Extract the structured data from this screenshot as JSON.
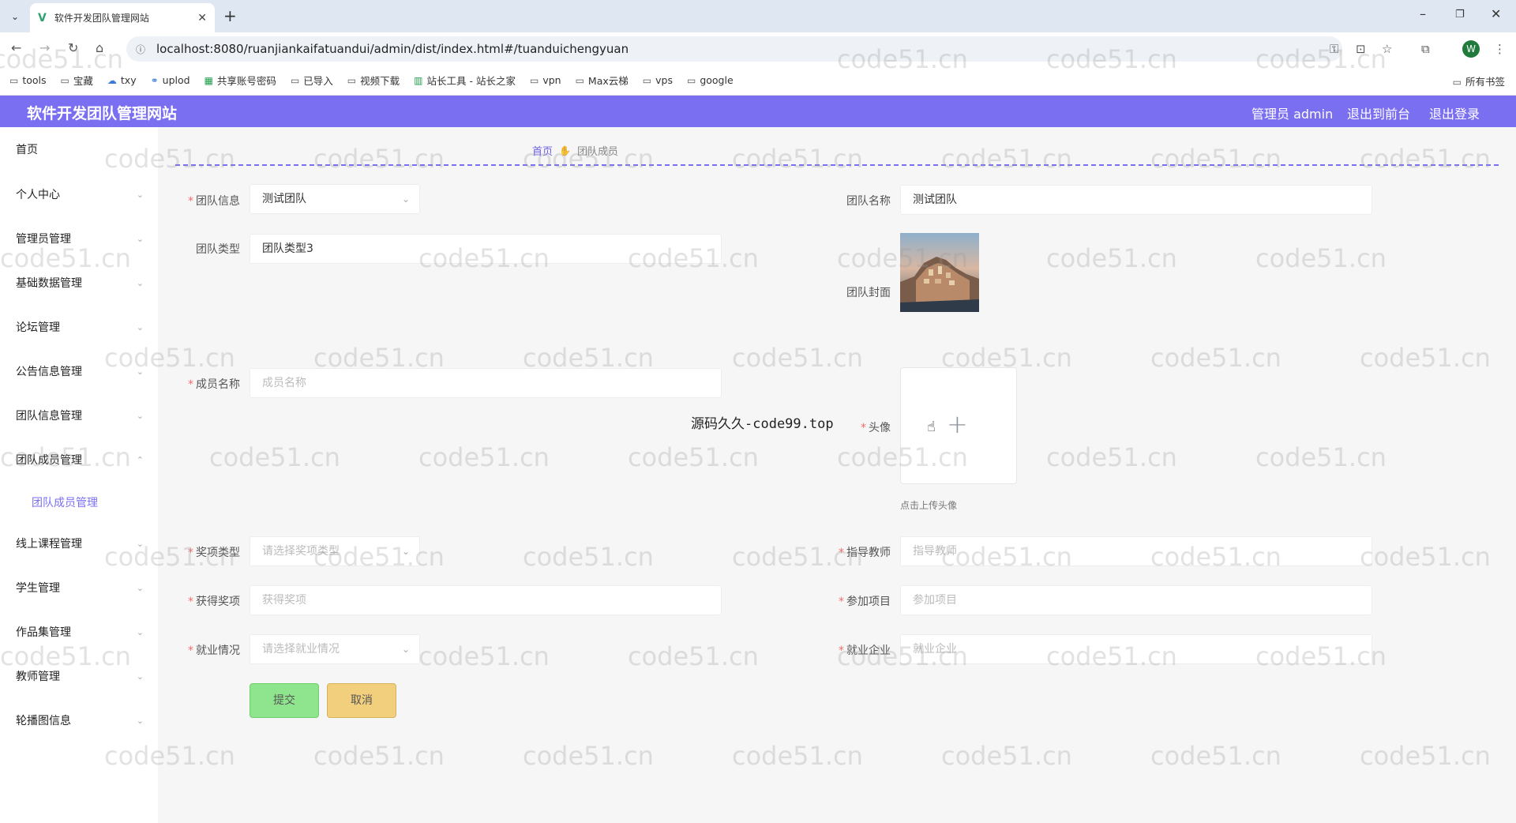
{
  "browser": {
    "tab_title": "软件开发团队管理网站",
    "url": "localhost:8080/ruanjiankaifatuandui/admin/dist/index.html#/tuanduichengyuan",
    "avatar_letter": "W",
    "bookmarks": [
      "tools",
      "宝藏",
      "txy",
      "uplod",
      "共享账号密码",
      "已导入",
      "视频下载",
      "站长工具 - 站长之家",
      "vpn",
      "Max云梯",
      "vps",
      "google"
    ],
    "all_bookmarks": "所有书签"
  },
  "header": {
    "title": "软件开发团队管理网站",
    "admin": "管理员 admin",
    "to_front": "退出到前台",
    "logout": "退出登录"
  },
  "sidebar": {
    "items": [
      "首页",
      "个人中心",
      "管理员管理",
      "基础数据管理",
      "论坛管理",
      "公告信息管理",
      "团队信息管理",
      "团队成员管理",
      "线上课程管理",
      "学生管理",
      "作品集管理",
      "教师管理",
      "轮播图信息"
    ],
    "active_sub": "团队成员管理"
  },
  "breadcrumb": {
    "home": "首页",
    "current": "团队成员"
  },
  "form": {
    "team_info_label": "团队信息",
    "team_info_value": "测试团队",
    "team_name_label": "团队名称",
    "team_name_value": "测试团队",
    "team_type_label": "团队类型",
    "team_type_value": "团队类型3",
    "cover_label": "团队封面",
    "member_name_label": "成员名称",
    "member_name_placeholder": "成员名称",
    "avatar_label": "头像",
    "avatar_hint": "点击上传头像",
    "award_type_label": "奖项类型",
    "award_type_placeholder": "请选择奖项类型",
    "advisor_label": "指导教师",
    "advisor_placeholder": "指导教师",
    "award_label": "获得奖项",
    "award_placeholder": "获得奖项",
    "project_label": "参加项目",
    "project_placeholder": "参加项目",
    "employment_label": "就业情况",
    "employment_placeholder": "请选择就业情况",
    "company_label": "就业企业",
    "company_placeholder": "就业企业",
    "submit": "提交",
    "cancel": "取消"
  },
  "overlay_text": "源码久久-code99.top",
  "watermark": "code51.cn",
  "colors": {
    "header": "#7b6ff1",
    "submit": "#8fe58d",
    "cancel": "#f1cf7c",
    "required": "#f56c6c"
  }
}
